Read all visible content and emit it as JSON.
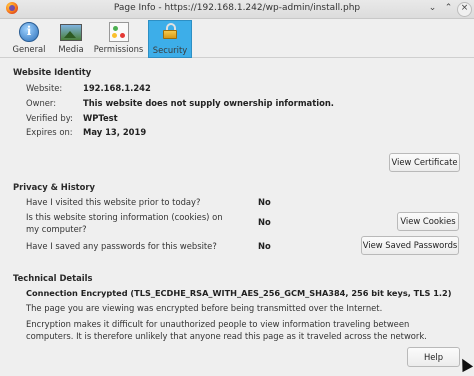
{
  "window": {
    "title": "Page Info - https://192.168.1.242/wp-admin/install.php",
    "controls": [
      "minimize",
      "maximize",
      "close"
    ]
  },
  "tabs": [
    {
      "label": "General",
      "icon": "info-icon",
      "active": false
    },
    {
      "label": "Media",
      "icon": "media-icon",
      "active": false
    },
    {
      "label": "Permissions",
      "icon": "permissions-icon",
      "active": false
    },
    {
      "label": "Security",
      "icon": "lock-icon",
      "active": true
    }
  ],
  "identity": {
    "heading": "Website Identity",
    "website_label": "Website:",
    "website_value": "192.168.1.242",
    "owner_label": "Owner:",
    "owner_value": "This website does not supply ownership information.",
    "verified_label": "Verified by:",
    "verified_value": "WPTest",
    "expires_label": "Expires on:",
    "expires_value": "May 13, 2019",
    "view_certificate": "View Certificate"
  },
  "privacy": {
    "heading": "Privacy & History",
    "q1": "Have I visited this website prior to today?",
    "a1": "No",
    "q2": "Is this website storing information (cookies) on my computer?",
    "a2": "No",
    "view_cookies": "View Cookies",
    "q3": "Have I saved any passwords for this website?",
    "a3": "No",
    "view_passwords": "View Saved Passwords"
  },
  "technical": {
    "heading": "Technical Details",
    "connection": "Connection Encrypted (TLS_ECDHE_RSA_WITH_AES_256_GCM_SHA384, 256 bit keys, TLS 1.2)",
    "line1": "The page you are viewing was encrypted before being transmitted over the Internet.",
    "line2": "Encryption makes it difficult for unauthorized people to view information traveling between computers. It is therefore unlikely that anyone read this page as it traveled across the network."
  },
  "footer": {
    "help": "Help"
  },
  "colors": {
    "accent": "#3daee9",
    "background": "#efefef"
  }
}
